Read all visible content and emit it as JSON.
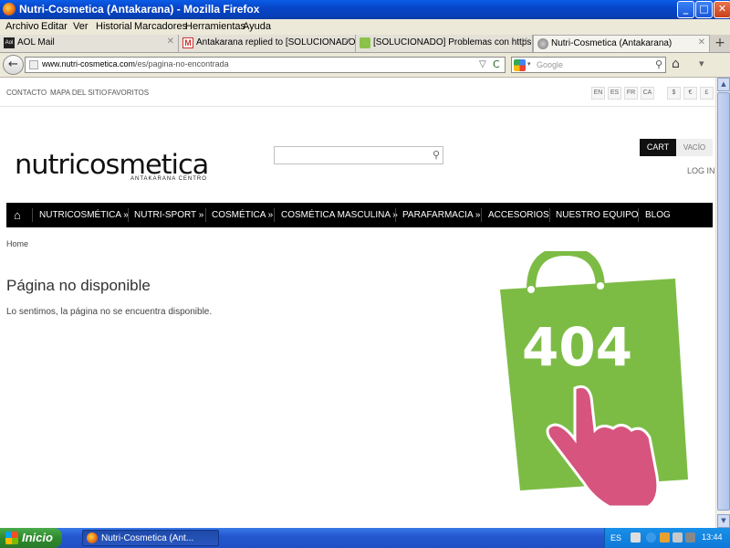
{
  "window": {
    "title": "Nutri-Cosmetica (Antakarana) - Mozilla Firefox",
    "min": "_",
    "max": "□",
    "close": "✕"
  },
  "menu": [
    "Archivo",
    "Editar",
    "Ver",
    "Historial",
    "Marcadores",
    "Herramientas",
    "Ayuda"
  ],
  "tabs": [
    {
      "label": "AOL Mail",
      "icon": "aol-icon"
    },
    {
      "label": "Antakarana replied to [SOLUCIONADO] ...",
      "icon": "gmail-icon"
    },
    {
      "label": "[SOLUCIONADO] Problemas con https - ...",
      "icon": "forum-icon"
    },
    {
      "label": "Nutri-Cosmetica (Antakarana)",
      "icon": "page-icon"
    }
  ],
  "tab_close": "✕",
  "new_tab": "+",
  "nav": {
    "back": "←",
    "url_host": "www.nutri-cosmetica.com",
    "url_path": "/es/pagina-no-encontrada",
    "star": "▽",
    "reload": "C",
    "search_placeholder": "Google",
    "search_icon": "⚲",
    "home": "⌂",
    "addon": "▾"
  },
  "site": {
    "topnav": [
      "CONTACTO",
      "MAPA DEL SITIO",
      "FAVORITOS"
    ],
    "languages": [
      "EN",
      "ES",
      "FR",
      "CA"
    ],
    "currencies": [
      "$",
      "€",
      "£"
    ],
    "logo_text": "nutricosmetica",
    "logo_sub": "ANTAKARANA CENTRO",
    "search_icon": "⚲",
    "cart_label": "CART",
    "cart_status": "VACÍO",
    "login": "LOG IN",
    "home_icon": "⌂",
    "menu_items": [
      "NUTRICOSMÉTICA »",
      "NUTRI-SPORT »",
      "COSMÉTICA »",
      "COSMÉTICA MASCULINA »",
      "PARAFARMACIA »",
      "ACCESORIOS",
      "NUESTRO EQUIPO",
      "BLOG"
    ],
    "breadcrumb": "Home",
    "page_title": "Página no disponible",
    "message": "Lo sentimos, la página no se encuentra disponible.",
    "error_code": "404",
    "colors": {
      "bag_green": "#7cbc45",
      "hand_pink": "#d6547e",
      "nav_black": "#000000"
    }
  },
  "scrollbar": {
    "up": "▲",
    "down": "▼"
  },
  "taskbar": {
    "start": "Inicio",
    "window_item": "Nutri-Cosmetica (Ant...",
    "lang": "ES",
    "time": "13:44"
  }
}
